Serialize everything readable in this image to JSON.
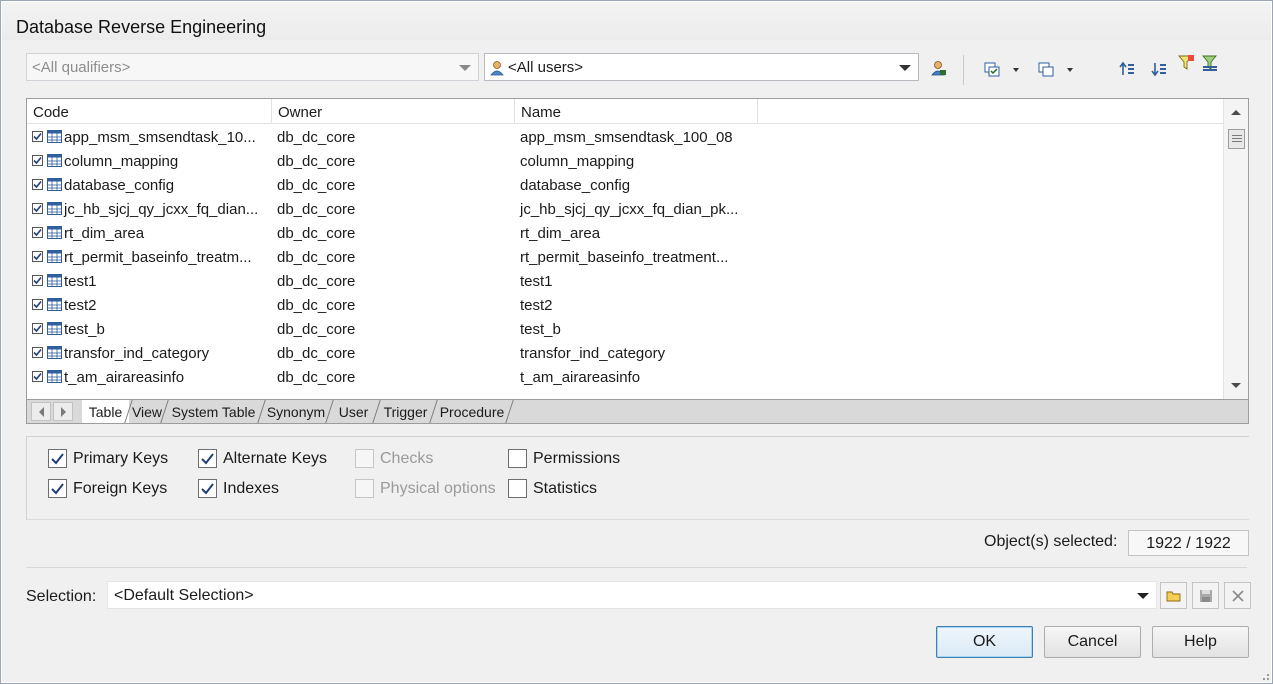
{
  "window": {
    "title": "Database Reverse Engineering"
  },
  "filters": {
    "qualifiers": {
      "value": "<All qualifiers>",
      "enabled": false
    },
    "users": {
      "value": "<All users>"
    }
  },
  "toolbar": {
    "icons": [
      "owner-user-icon",
      "select-all-icon",
      "deselect-icon",
      "move-up-icon",
      "move-down-icon",
      "filter-icon",
      "filter-clear-icon"
    ]
  },
  "list": {
    "columns": [
      "Code",
      "Owner",
      "Name"
    ],
    "rows": [
      {
        "checked": true,
        "code": "app_msm_smsendtask_10...",
        "owner": "db_dc_core",
        "name": "app_msm_smsendtask_100_08"
      },
      {
        "checked": true,
        "code": "column_mapping",
        "owner": "db_dc_core",
        "name": "column_mapping"
      },
      {
        "checked": true,
        "code": "database_config",
        "owner": "db_dc_core",
        "name": "database_config"
      },
      {
        "checked": true,
        "code": "jc_hb_sjcj_qy_jcxx_fq_dian...",
        "owner": "db_dc_core",
        "name": "jc_hb_sjcj_qy_jcxx_fq_dian_pk..."
      },
      {
        "checked": true,
        "code": "rt_dim_area",
        "owner": "db_dc_core",
        "name": "rt_dim_area"
      },
      {
        "checked": true,
        "code": "rt_permit_baseinfo_treatm...",
        "owner": "db_dc_core",
        "name": "rt_permit_baseinfo_treatment..."
      },
      {
        "checked": true,
        "code": "test1",
        "owner": "db_dc_core",
        "name": "test1"
      },
      {
        "checked": true,
        "code": "test2",
        "owner": "db_dc_core",
        "name": "test2"
      },
      {
        "checked": true,
        "code": "test_b",
        "owner": "db_dc_core",
        "name": "test_b"
      },
      {
        "checked": true,
        "code": "transfor_ind_category",
        "owner": "db_dc_core",
        "name": "transfor_ind_category"
      },
      {
        "checked": true,
        "code": "t_am_airareasinfo",
        "owner": "db_dc_core",
        "name": "t_am_airareasinfo"
      }
    ]
  },
  "tabs": {
    "items": [
      "Table",
      "View",
      "System Table",
      "Synonym",
      "User",
      "Trigger",
      "Procedure"
    ],
    "active": "Table"
  },
  "options": {
    "primary_keys": {
      "label": "Primary Keys",
      "checked": true
    },
    "foreign_keys": {
      "label": "Foreign Keys",
      "checked": true
    },
    "alternate_keys": {
      "label": "Alternate Keys",
      "checked": true
    },
    "indexes": {
      "label": "Indexes",
      "checked": true
    },
    "checks": {
      "label": "Checks",
      "checked": false,
      "enabled": false
    },
    "physical_options": {
      "label": "Physical options",
      "checked": false,
      "enabled": false
    },
    "permissions": {
      "label": "Permissions",
      "checked": false
    },
    "statistics": {
      "label": "Statistics",
      "checked": false
    }
  },
  "status": {
    "selected_label": "Object(s) selected:",
    "selected_value": "1922 / 1922"
  },
  "selection": {
    "label": "Selection:",
    "value": "<Default Selection>"
  },
  "buttons": {
    "ok": "OK",
    "cancel": "Cancel",
    "help": "Help"
  },
  "colors": {
    "check": "#1f3f77",
    "table_icon": "#2f5f9c",
    "default_button_border": "#3c7fb1"
  }
}
